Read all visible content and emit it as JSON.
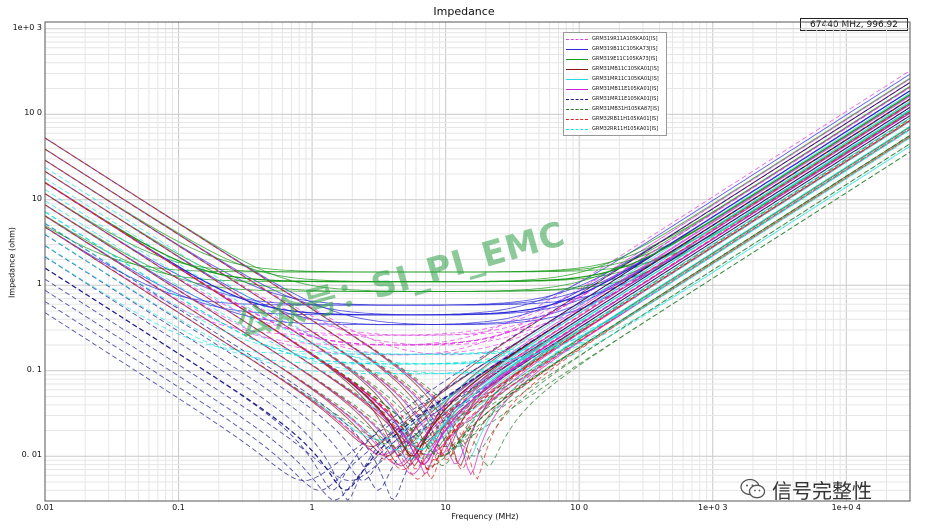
{
  "chart_data": {
    "type": "line",
    "title": "Impedance",
    "xlabel": "Frequency (MHz)",
    "ylabel": "Impedance (ohm)",
    "xscale": "log",
    "yscale": "log",
    "xlim": [
      0.01,
      30000
    ],
    "ylim": [
      0.003,
      1200
    ],
    "grid": true,
    "legend_position": "top-right",
    "cursor_readout": "67440 MHz, 996.92",
    "x_ticks": [
      {
        "value": 0.01,
        "label": "0.01"
      },
      {
        "value": 0.1,
        "label": "0.1"
      },
      {
        "value": 1,
        "label": "1"
      },
      {
        "value": 10,
        "label": "10"
      },
      {
        "value": 100,
        "label": "10 0"
      },
      {
        "value": 1000,
        "label": "1e+0 3"
      },
      {
        "value": 10000,
        "label": "1e+0 4"
      }
    ],
    "y_ticks": [
      {
        "value": 1000,
        "label": "1e+0 3"
      },
      {
        "value": 100,
        "label": "10 0"
      },
      {
        "value": 10,
        "label": "10"
      },
      {
        "value": 1,
        "label": "1"
      },
      {
        "value": 0.1,
        "label": "0. 1"
      },
      {
        "value": 0.01,
        "label": "0. 01"
      }
    ],
    "series": [
      {
        "name": "GRM319R11A105KA01[IS]",
        "color": "#e040e0",
        "dash": "dashed",
        "c_uf": 1.0,
        "esr": 0.2,
        "esl_nh": 1.1
      },
      {
        "name": "GRM319B11C105KA73[IS]",
        "color": "#2b2bd8",
        "dash": "solid",
        "c_uf": 1.0,
        "esr": 0.45,
        "esl_nh": 1.0
      },
      {
        "name": "GRM319E11C105KA73[IS]",
        "color": "#1a9a1a",
        "dash": "solid",
        "c_uf": 1.0,
        "esr": 1.1,
        "esl_nh": 0.9
      },
      {
        "name": "GRM31MB11C105KA01[IS]",
        "color": "#8b1a1a",
        "dash": "solid",
        "c_uf": 1.0,
        "esr": 0.01,
        "esl_nh": 0.8
      },
      {
        "name": "GRM31MR11C105KA01[IS]",
        "color": "#22d8e0",
        "dash": "solid",
        "c_uf": 1.0,
        "esr": 0.012,
        "esl_nh": 0.6
      },
      {
        "name": "GRM31MB11E105KA01[IS]",
        "color": "#d020d0",
        "dash": "solid",
        "c_uf": 1.0,
        "esr": 0.008,
        "esl_nh": 0.55
      },
      {
        "name": "GRM31MR11E105KA01[IS]",
        "color": "#1a1a8a",
        "dash": "dashed",
        "c_uf": 10.0,
        "esr": 0.004,
        "esl_nh": 0.8
      },
      {
        "name": "GRM31MB31H105KA87[IS]",
        "color": "#2a7a2a",
        "dash": "dashed",
        "c_uf": 1.0,
        "esr": 0.01,
        "esl_nh": 0.3
      },
      {
        "name": "GRM32RB11H105KA01[IS]",
        "color": "#e02020",
        "dash": "dashed",
        "c_uf": 1.0,
        "esr": 0.007,
        "esl_nh": 0.45
      },
      {
        "name": "GRM32RR11H105KA01[IS]",
        "color": "#22e0e0",
        "dash": "dashed",
        "c_uf": 2.2,
        "esr": 0.12,
        "esl_nh": 0.35
      }
    ]
  },
  "watermark": "公众号：SI_PI_EMC",
  "wechat_label": "信号完整性",
  "icons": {
    "wechat": "wechat-icon"
  }
}
